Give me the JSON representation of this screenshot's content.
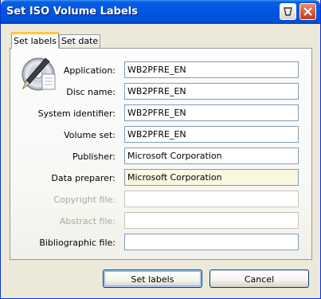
{
  "window": {
    "title": "Set ISO Volume Labels"
  },
  "tabs": [
    {
      "label": "Set labels",
      "active": true
    },
    {
      "label": "Set date",
      "active": false
    }
  ],
  "icon": "cd-disc-with-pen-icon",
  "fields": [
    {
      "label": "Application:",
      "value": "WB2PFRE_EN",
      "enabled": true
    },
    {
      "label": "Disc name:",
      "value": "WB2PFRE_EN",
      "enabled": true
    },
    {
      "label": "System identifier:",
      "value": "WB2PFRE_EN",
      "enabled": true
    },
    {
      "label": "Volume set:",
      "value": "WB2PFRE_EN",
      "enabled": true
    },
    {
      "label": "Publisher:",
      "value": "Microsoft Corporation",
      "enabled": true
    },
    {
      "label": "Data preparer:",
      "value": "Microsoft Corporation",
      "enabled": true,
      "focused": true
    },
    {
      "label": "Copyright file:",
      "value": "",
      "enabled": false
    },
    {
      "label": "Abstract file:",
      "value": "",
      "enabled": false
    },
    {
      "label": "Bibliographic file:",
      "value": "",
      "enabled": true
    }
  ],
  "buttons": {
    "ok_label": "Set labels",
    "cancel_label": "Cancel"
  },
  "colors": {
    "titlebar": "#0355e3",
    "window_bg": "#ece9d8",
    "tab_highlight": "#ffc83c",
    "focused_field_bg": "#fbf8e0"
  }
}
